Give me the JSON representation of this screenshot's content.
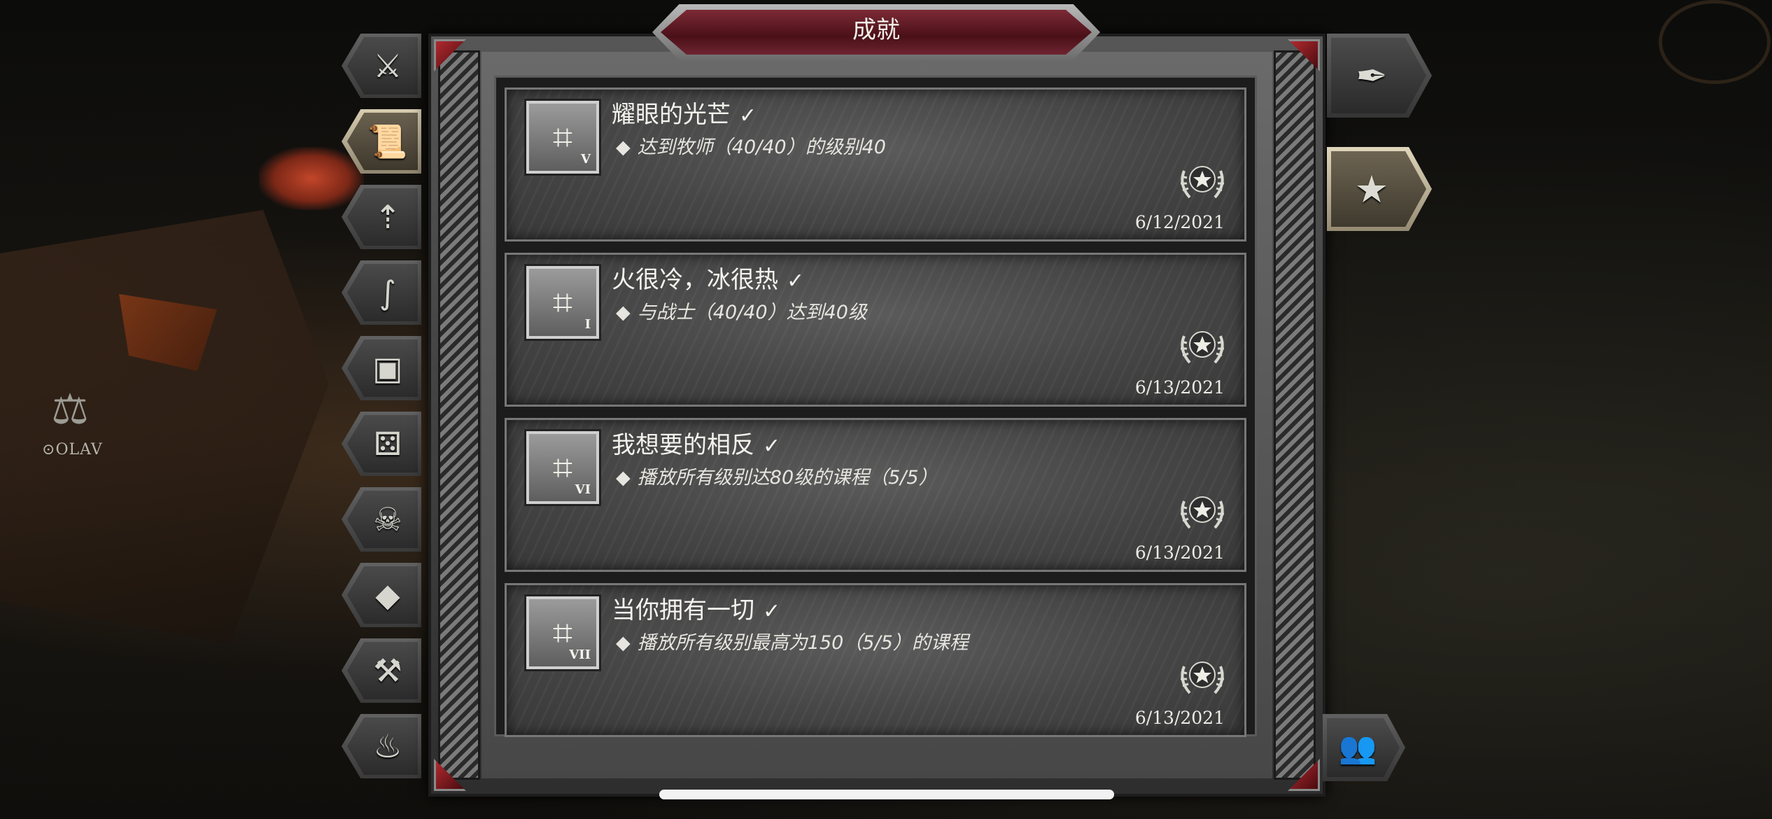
{
  "header": {
    "title": "成就"
  },
  "background": {
    "npc_label": "OLAV"
  },
  "left_tabs": [
    {
      "icon": "sword-icon",
      "glyph": "⚔",
      "active": false
    },
    {
      "icon": "scroll-icon",
      "glyph": "📜",
      "active": true
    },
    {
      "icon": "winged-arrow-icon",
      "glyph": "⇡",
      "active": false
    },
    {
      "icon": "serpent-icon",
      "glyph": "∫",
      "active": false
    },
    {
      "icon": "chest-icon",
      "glyph": "▣",
      "active": false
    },
    {
      "icon": "dice-icon",
      "glyph": "⚄",
      "active": false
    },
    {
      "icon": "demon-skull-icon",
      "glyph": "☠",
      "active": false
    },
    {
      "icon": "gem-icon",
      "glyph": "◆",
      "active": false
    },
    {
      "icon": "crossed-hammers-icon",
      "glyph": "⚒",
      "active": false
    },
    {
      "icon": "cauldron-icon",
      "glyph": "♨",
      "active": false
    }
  ],
  "right_tabs": [
    {
      "icon": "quill-icon",
      "glyph": "✒",
      "active": false
    },
    {
      "icon": "laurel-star-icon",
      "glyph": "★",
      "active": true
    },
    {
      "icon": "party-icon",
      "glyph": "👥",
      "active": false
    }
  ],
  "achievements": [
    {
      "title": "耀眼的光芒",
      "check": "✓",
      "diamond": "◆",
      "desc": "达到牧师（40/40）的级别40",
      "roman": "V",
      "date": "6/12/2021"
    },
    {
      "title": "火很冷，冰很热",
      "check": "✓",
      "diamond": "◆",
      "desc": "与战士（40/40）达到40级",
      "roman": "I",
      "date": "6/13/2021"
    },
    {
      "title": "我想要的相反",
      "check": "✓",
      "diamond": "◆",
      "desc": "播放所有级别达80级的课程（5/5）",
      "roman": "VI",
      "date": "6/13/2021"
    },
    {
      "title": "当你拥有一切",
      "check": "✓",
      "diamond": "◆",
      "desc": "播放所有级别最高为150（5/5）的课程",
      "roman": "VII",
      "date": "6/13/2021"
    }
  ]
}
